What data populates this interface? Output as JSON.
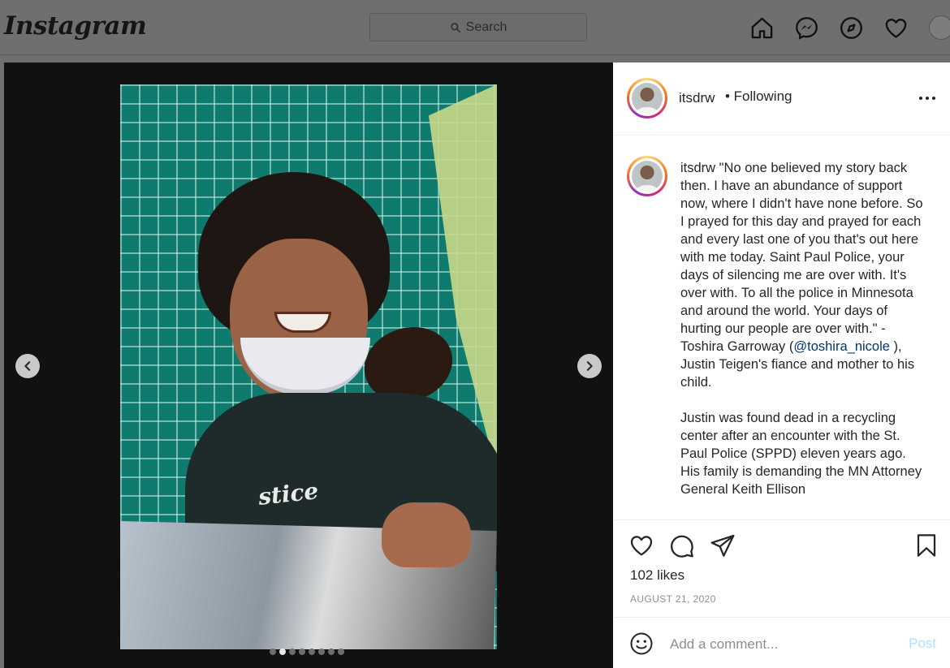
{
  "nav": {
    "logo": "Instagram",
    "search_placeholder": "Search",
    "icons": [
      "home-icon",
      "messenger-icon",
      "explore-icon",
      "heart-icon",
      "profile-avatar"
    ]
  },
  "carousel": {
    "slide_count": 8,
    "active_index": 1,
    "photo_shirt_text": "stice"
  },
  "post": {
    "username": "itsdrw",
    "follow_status": "• Following",
    "caption_user": "itsdrw",
    "caption_part1": " \"No one believed my story back then. I have an abundance of support now, where I didn't have none before. So I prayed for this day and prayed for each and every last one of you that's out here with me today. Saint Paul Police, your days of silencing me are over with. It's over with. To all the police in Minnesota and around the world. Your days of hurting our people are over with.\" - Toshira Garroway (",
    "caption_mention": "@toshira_nicole",
    "caption_part2": " ), Justin Teigen's fiance and mother to his child.\n\nJustin was found dead in a recycling center after an encounter with the St. Paul Police (SPPD) eleven years ago. His family is demanding the MN Attorney General Keith Ellison",
    "likes": "102 likes",
    "date": "AUGUST 21, 2020",
    "comment_placeholder": "Add a comment...",
    "post_label": "Post"
  },
  "colors": {
    "overlay": "#6f6f6f",
    "text": "#262626",
    "muted": "#8e8e8e",
    "link": "#00376b",
    "post_disabled": "#b2dffc"
  }
}
